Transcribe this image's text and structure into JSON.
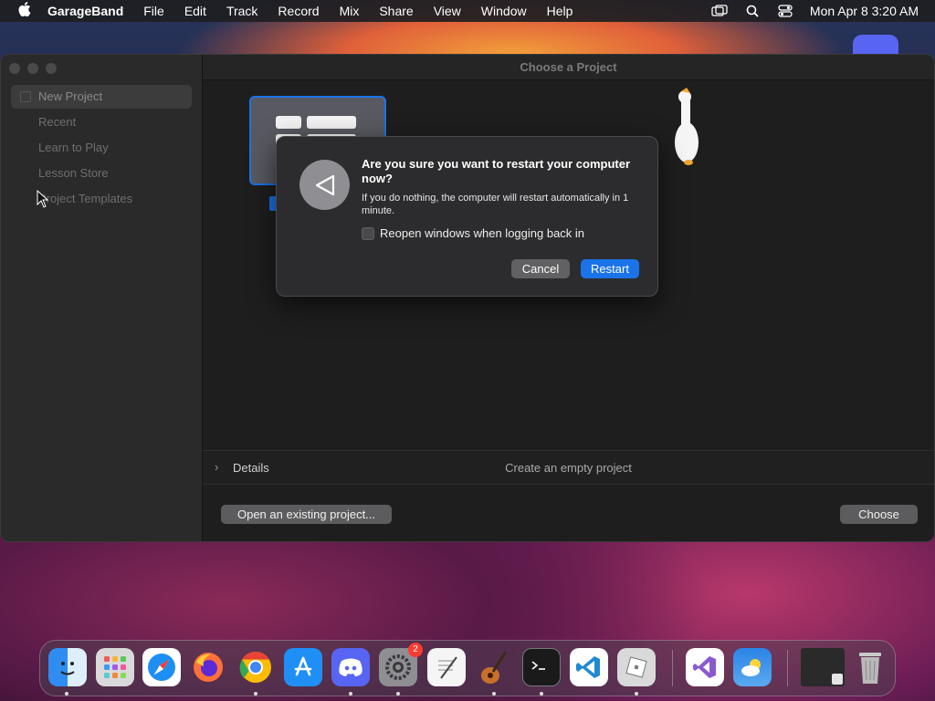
{
  "menubar": {
    "app_name": "GarageBand",
    "items": [
      "File",
      "Edit",
      "Track",
      "Record",
      "Mix",
      "Share",
      "View",
      "Window",
      "Help"
    ],
    "clock": "Mon Apr 8  3:20 AM"
  },
  "window": {
    "title": "Choose a Project",
    "sidebar": {
      "items": [
        {
          "label": "New Project",
          "selected": true
        },
        {
          "label": "Recent"
        },
        {
          "label": "Learn to Play"
        },
        {
          "label": "Lesson Store"
        },
        {
          "label": "Project Templates"
        }
      ]
    },
    "details": {
      "label": "Details",
      "description": "Create an empty project"
    },
    "buttons": {
      "open_existing": "Open an existing project...",
      "choose": "Choose"
    }
  },
  "alert": {
    "title": "Are you sure you want to restart your computer now?",
    "message": "If you do nothing, the computer will restart automatically in 1 minute.",
    "checkbox_label": "Reopen windows when logging back in",
    "cancel": "Cancel",
    "restart": "Restart"
  },
  "dock": {
    "apps": [
      {
        "name": "finder-icon",
        "color": "#2f8cf0"
      },
      {
        "name": "launchpad-icon",
        "color": "#d9d9d9"
      },
      {
        "name": "safari-icon",
        "color": "#ffffff"
      },
      {
        "name": "firefox-icon",
        "color": "#ff7139"
      },
      {
        "name": "chrome-icon",
        "color": "#ffffff"
      },
      {
        "name": "app-store-icon",
        "color": "#1f8ff5"
      },
      {
        "name": "discord-icon",
        "color": "#5865f2"
      },
      {
        "name": "system-settings-icon",
        "color": "#8e8e93",
        "badge": "2"
      },
      {
        "name": "textedit-icon",
        "color": "#f5f5f5"
      },
      {
        "name": "garageband-icon",
        "color": "#4a2f1a"
      },
      {
        "name": "terminal-icon",
        "color": "#1a1a1a"
      },
      {
        "name": "vscode-icon",
        "color": "#ffffff"
      },
      {
        "name": "roblox-icon",
        "color": "#d9d9d9"
      },
      {
        "name": "visual-studio-icon",
        "color": "#ffffff"
      },
      {
        "name": "weather-icon",
        "color": "#2b84e6"
      },
      {
        "name": "recent-window-icon",
        "color": "#2a2a2a"
      },
      {
        "name": "trash-icon",
        "color": "#b9b9b9"
      }
    ]
  }
}
